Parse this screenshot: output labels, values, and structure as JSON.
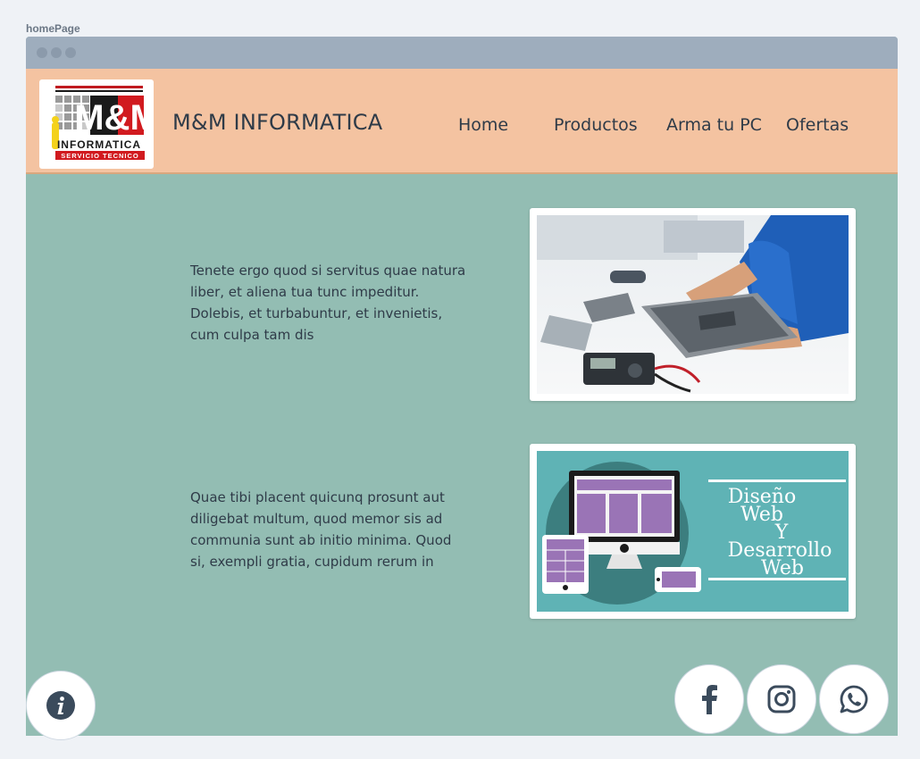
{
  "frame_label": "homePage",
  "header": {
    "brand": "M&M INFORMATICA",
    "logo": {
      "word1": "M&M",
      "word2": "INFORMATICA",
      "tagline": "SERVICIO TECNICO"
    },
    "nav": [
      "Home",
      "Productos",
      "Arma tu PC",
      "Ofertas"
    ]
  },
  "main": {
    "rows": [
      {
        "text": "Tenete ergo quod si servitus quae natura liber, et aliena tua tunc impeditur. Dolebis, et turbabuntur, et invenietis, cum culpa tam dis",
        "image_icon": "technician-repairing-laptop"
      },
      {
        "text": "Quae tibi placent quicunq prosunt aut diligebat multum, quod memor sis ad communia sunt ab initio minima. Quod si, exempli gratia, cupidum rerum in",
        "image_icon": "web-design-devices",
        "banner": [
          "Diseño",
          "Web",
          "Y",
          "Desarrollo",
          "Web"
        ]
      }
    ]
  },
  "floating": {
    "info_icon": "info-icon",
    "social": [
      "facebook-icon",
      "instagram-icon",
      "whatsapp-icon"
    ]
  },
  "colors": {
    "header_bg": "#f4c3a1",
    "body_bg": "#93bdb3",
    "text": "#2f3b48",
    "banner_bg": "#5fb3b5",
    "device_purple": "#9a74b6"
  }
}
